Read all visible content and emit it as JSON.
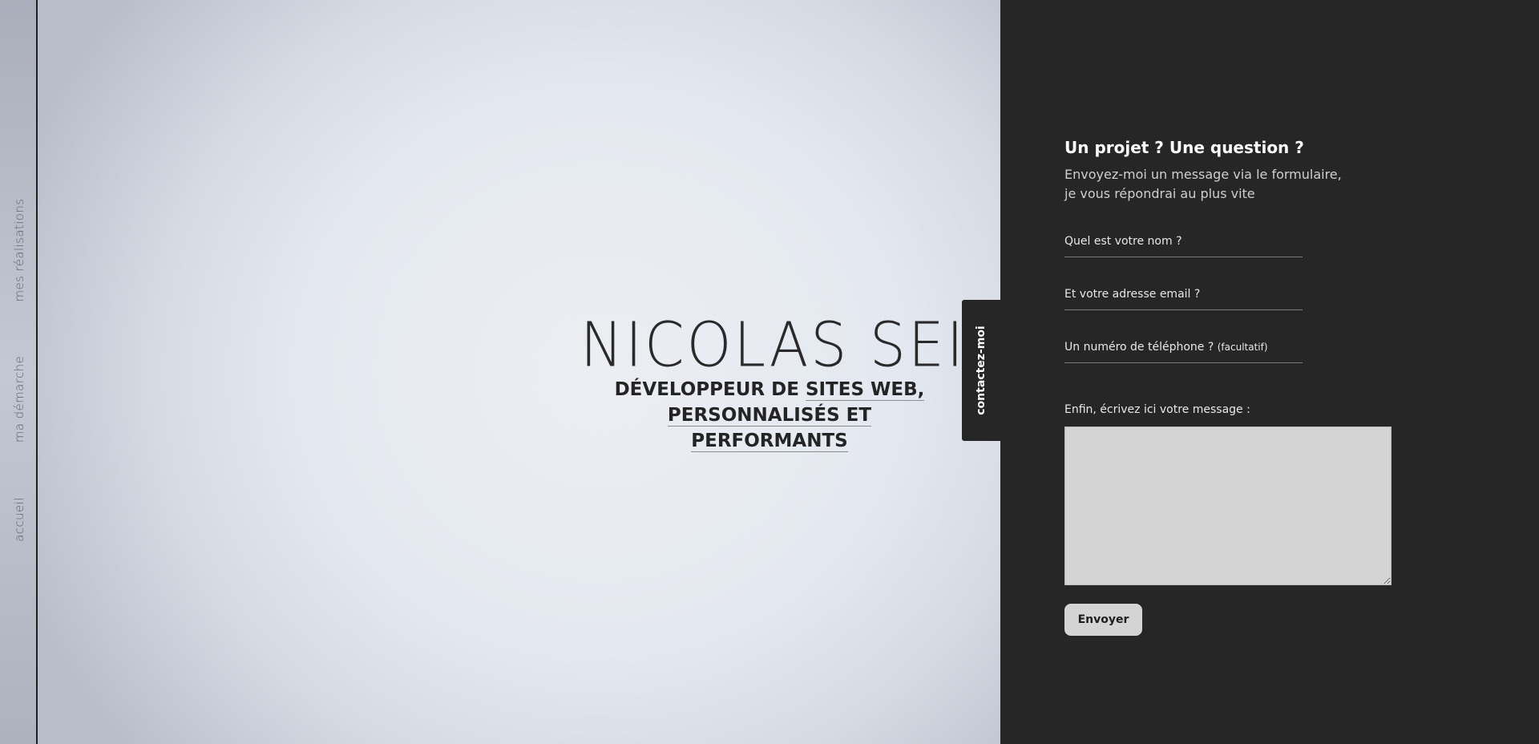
{
  "nav": {
    "items": [
      {
        "label": "mes réalisations"
      },
      {
        "label": "ma démarche"
      },
      {
        "label": "accueil"
      }
    ]
  },
  "hero": {
    "name": "NICOLAS SEINE",
    "tagline_part1": "DÉVELOPPEUR DE ",
    "tagline_link1": "SITES WEB,",
    "tagline_link2": "PERSONNALISÉS ET PERFORMANTS"
  },
  "contact_tab": {
    "label": "contactez-moi"
  },
  "form": {
    "title": "Un projet ? Une question ?",
    "intro_line1": "Envoyez-moi un message via le formulaire,",
    "intro_line2": "je vous répondrai au plus vite",
    "name_label": "Quel est votre nom ?",
    "email_label": "Et votre adresse email ?",
    "phone_label": "Un numéro de téléphone ?",
    "phone_optional": "(facultatif)",
    "message_label": "Enfin, écrivez ici votre message :",
    "submit_label": "Envoyer"
  },
  "colors": {
    "panel_bg": "#262626",
    "button_bg": "#d4d4d4",
    "hero_text": "#2a2a2a"
  }
}
